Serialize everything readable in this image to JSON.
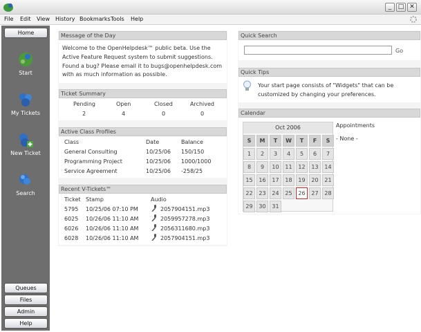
{
  "window": {
    "minimize": "_",
    "maximize": "□",
    "close": "✕"
  },
  "menu": [
    "File",
    "Edit",
    "View",
    "History",
    "Bookmarks",
    "Tools",
    "Help"
  ],
  "sidebar": {
    "home_label": "Home",
    "nav": [
      {
        "label": "Start",
        "icon": "start-icon"
      },
      {
        "label": "My Tickets",
        "icon": "tickets-icon"
      },
      {
        "label": "New Ticket",
        "icon": "new-ticket-icon"
      },
      {
        "label": "Search",
        "icon": "search-icon"
      }
    ],
    "bottom": [
      "Queues",
      "Files",
      "Admin",
      "Help"
    ]
  },
  "motd": {
    "title": "Message of the Day",
    "lines": [
      "Welcome to the OpenHelpdesk™ public beta. Use the",
      "Active Feature Request system to submit suggestions.",
      "Found a bug? Please email it to bugs@openhelpdesk.com",
      "with as much information as possible."
    ]
  },
  "ticket_summary": {
    "title": "Ticket Summary",
    "headers": [
      "Pending",
      "Open",
      "Closed",
      "Archived"
    ],
    "values": [
      "2",
      "4",
      "0",
      "0"
    ]
  },
  "class_profiles": {
    "title": "Active Class Profiles",
    "headers": [
      "Class",
      "Date",
      "Balance"
    ],
    "rows": [
      [
        "General Consulting",
        "10/25/06",
        "150/150"
      ],
      [
        "Programming Project",
        "10/25/06",
        "1000/1000"
      ],
      [
        "Service Agreement",
        "10/25/06",
        "-258/25"
      ]
    ]
  },
  "vtickets": {
    "title": "Recent V-Tickets™",
    "headers": [
      "Ticket",
      "Stamp",
      "Audio"
    ],
    "rows": [
      [
        "5795",
        "10/25/06 07:10 PM",
        "2057904151.mp3"
      ],
      [
        "6025",
        "10/26/06 11:10 AM",
        "2059957278.mp3"
      ],
      [
        "6026",
        "10/26/06 11:10 AM",
        "2056311680.mp3"
      ],
      [
        "6028",
        "10/26/06 11:10 AM",
        "2057904151.mp3"
      ]
    ]
  },
  "quick_search": {
    "title": "Quick Search",
    "button": "Go"
  },
  "quick_tips": {
    "title": "Quick Tips",
    "lines": [
      "Your start page consists of \"Widgets\" that can be",
      "customized by changing your preferences."
    ]
  },
  "calendar": {
    "title": "Calendar",
    "month": "Oct 2006",
    "days": [
      "S",
      "M",
      "T",
      "W",
      "T",
      "F",
      "S"
    ],
    "weeks": [
      [
        "1",
        "2",
        "3",
        "4",
        "5",
        "6",
        "7"
      ],
      [
        "8",
        "9",
        "10",
        "11",
        "12",
        "13",
        "14"
      ],
      [
        "15",
        "16",
        "17",
        "18",
        "19",
        "20",
        "21"
      ],
      [
        "22",
        "23",
        "24",
        "25",
        "26",
        "27",
        "28"
      ],
      [
        "29",
        "30",
        "31",
        "",
        "",
        "",
        ""
      ]
    ],
    "today": "26",
    "appointments_label": "Appointments",
    "appointments_value": "- None -"
  }
}
